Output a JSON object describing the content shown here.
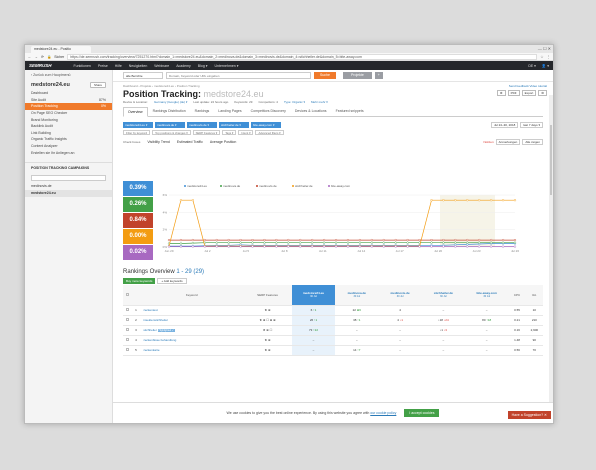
{
  "browser": {
    "tab_title": "medstore24.eu - Positio",
    "window_controls": "— ☐ ✕",
    "secure_label": "Sicher",
    "url": "https://de.semrush.com/tracking/overview/7251270.html?domain_1=medstore24.eu&domain_2=medinova.de&domain_3=medinovis.de&domain_4=stichheiler.de&domain_5=bite-away.com"
  },
  "nav": {
    "logo": "SEMRUSH",
    "items": [
      "Funktionen",
      "Preise",
      "Hilfe",
      "Neuigkeiten",
      "Webinare",
      "Academy",
      "Blog ▾",
      "Unternehmen ▾"
    ],
    "right": [
      "DE ▾",
      "👤 ▾"
    ]
  },
  "sidebar": {
    "back": "‹  Zurück zum Hauptmenü",
    "project": "medstore24.eu",
    "share": "Share",
    "items": [
      {
        "label": "Dashboard",
        "badge": ""
      },
      {
        "label": "Site Audit",
        "badge": "87%"
      },
      {
        "label": "Position Tracking",
        "badge": "0%"
      },
      {
        "label": "On Page SEO Checker",
        "badge": ""
      },
      {
        "label": "Brand Monitoring",
        "badge": ""
      },
      {
        "label": "Backlink Audit",
        "badge": ""
      },
      {
        "label": "Link Building",
        "badge": ""
      },
      {
        "label": "Organic Traffic Insights",
        "badge": ""
      },
      {
        "label": "Content Analyzer",
        "badge": ""
      },
      {
        "label": "Erstellen sie Ihr Anliegen an",
        "badge": ""
      }
    ],
    "campaigns_title": "POSITION TRACKING CAMPAIGNS",
    "campaign_search_placeholder": "",
    "campaigns": [
      "medinovis.de",
      "medstore24.eu"
    ]
  },
  "search": {
    "scope": "alle Berichte",
    "placeholder": "Domain, Keyword oder URL eingeben",
    "button": "Suche",
    "projects": "Projekte",
    "plus": "+"
  },
  "breadcrumbs": "Dashboard  ›  Projekte  ›  medstore24.eu  ›  Position Tracking",
  "page": {
    "title": "Position Tracking:",
    "title_domain": "medstore24.eu",
    "header_links": "Send feedback   Video tutorial",
    "header_buttons": [
      "⚙",
      "PDF",
      "Export",
      "⚙"
    ],
    "meta": [
      "Device & Location:",
      "Germany (Google) (de) ▾",
      "Last update: 24 hours ago",
      "Keywords: 29",
      "Competitors: 4",
      "Type: Organic ▾",
      "Mehr mehr ▾"
    ]
  },
  "tabs": [
    "Overview",
    "Rankings Distribution",
    "Rankings",
    "Landing Pages",
    "Competitors Discovery",
    "Devices & Locations",
    "Featured snippets"
  ],
  "filters": {
    "domains": [
      "medstore24.eu ▾",
      "medinova.de ▾",
      "medinovis.de ▾",
      "stichheiler.de ▾",
      "bite-away.com ▾"
    ],
    "date_range": "Jul 24–30, 2018",
    "days": "last 7 days ▾",
    "subfilters": [
      "Filter by keyword",
      "Top positions & changes ▾",
      "SERP Features ▾",
      "Tags ▾",
      "Intent ▾",
      "Advanced filters ▾"
    ]
  },
  "chart_header": {
    "check": "Check boxes",
    "visibility": "Visibility Trend",
    "traffic": "Estimated Traffic",
    "avgpos": "Average Position",
    "notes": "Notizen",
    "buttons": [
      "Anmerkungen",
      "Alle zeigen"
    ]
  },
  "metrics": [
    {
      "value": "0.39%",
      "color": "#3f8fd6"
    },
    {
      "value": "0.26%",
      "color": "#43a047"
    },
    {
      "value": "0.84%",
      "color": "#c1432b"
    },
    {
      "value": "0.00%",
      "color": "#f39c12"
    },
    {
      "value": "0.02%",
      "color": "#a869c1"
    }
  ],
  "chart_data": {
    "type": "line",
    "categories": [
      "Jun 29",
      "Jul 2",
      "Jul 5",
      "Jul 8",
      "Jul 11",
      "Jul 14",
      "Jul 17",
      "Jul 20",
      "Jul 23",
      "Jul 26"
    ],
    "ylim": [
      0,
      6
    ],
    "yticks": [
      "6%",
      "4%",
      "2%",
      "0%"
    ],
    "series": [
      {
        "name": "medstore24.eu",
        "color": "#3f8fd6",
        "values": [
          0.1,
          0.1,
          0.1,
          0.15,
          0.2,
          0.2,
          0.25,
          0.2,
          0.2,
          0.2,
          0.2,
          0.2,
          0.2,
          0.2,
          0.2,
          0.2,
          0.2,
          0.2,
          0.2,
          0.2,
          0.2,
          0.2,
          0.2,
          0.2,
          0.25,
          0.3,
          0.35,
          0.4,
          0.4,
          0.4
        ]
      },
      {
        "name": "medinova.de",
        "color": "#43a047",
        "values": [
          0.4,
          0.4,
          0.45,
          0.5,
          0.5,
          0.5,
          0.5,
          0.5,
          0.5,
          0.5,
          0.5,
          0.5,
          0.5,
          0.5,
          0.5,
          0.5,
          0.5,
          0.5,
          0.5,
          0.5,
          0.5,
          0.5,
          0.5,
          0.5,
          0.5,
          0.5,
          0.5,
          0.5,
          0.5,
          0.5
        ]
      },
      {
        "name": "medinovis.de",
        "color": "#c1432b",
        "values": [
          0.8,
          0.8,
          0.8,
          0.8,
          0.8,
          0.8,
          0.8,
          0.8,
          0.8,
          0.8,
          0.8,
          0.8,
          0.8,
          0.8,
          0.8,
          0.8,
          0.8,
          0.8,
          0.8,
          0.8,
          0.8,
          0.8,
          0.8,
          0.8,
          0.8,
          0.8,
          0.8,
          0.8,
          0.8,
          0.8
        ]
      },
      {
        "name": "stichheiler.de",
        "color": "#f39c12",
        "values": [
          0.1,
          5.4,
          5.4,
          0.1,
          0.1,
          0.1,
          0.1,
          0.1,
          0.1,
          0.1,
          0.1,
          0.1,
          0.1,
          0.1,
          0.1,
          0.1,
          0.1,
          0.1,
          0.1,
          0.1,
          0.1,
          0.1,
          5.4,
          5.4,
          5.4,
          5.4,
          5.4,
          5.4,
          5.4,
          5.4
        ]
      },
      {
        "name": "bite-away.com",
        "color": "#a869c1",
        "values": [
          0.05,
          0.05,
          0.05,
          0.05,
          0.05,
          0.05,
          0.05,
          0.05,
          0.05,
          0.05,
          0.05,
          0.05,
          0.05,
          0.05,
          0.05,
          0.05,
          0.05,
          0.05,
          0.05,
          0.05,
          0.05,
          0.05,
          0.05,
          0.05,
          0.05,
          0.05,
          0.05,
          0.05,
          0.05,
          0.05
        ]
      }
    ]
  },
  "rankings": {
    "title": "Rankings Overview",
    "count": "1 - 29 (29)",
    "buy": "Buy more keywords",
    "add": "+ Add keywords",
    "columns": [
      "",
      "",
      "Keyword",
      "SERP Features",
      "medstore24.eu",
      "medinova.de",
      "medinovis.de",
      "stichheiler.de",
      "bite-away.com",
      "CPC",
      "Vol."
    ],
    "subcols": [
      "30 Jul",
      "Diff"
    ],
    "rows": [
      {
        "n": "1",
        "kw": "zeckentest",
        "tag": "",
        "serp": "★ ⊕",
        "me": [
          "6",
          "↑1"
        ],
        "c1": [
          "22",
          "⊕6"
        ],
        "c2": [
          "4",
          ""
        ],
        "c3": [
          "–",
          ""
        ],
        "c4": [
          "–",
          ""
        ],
        "cpc": "0.55",
        "vol": "10"
      },
      {
        "n": "2",
        "kw": "insektenstichheiler",
        "tag": "",
        "serp": "★ ⊕ ☐ ⊕ ⊕",
        "me": [
          "26",
          "↑1"
        ],
        "c1": [
          "38",
          "↑1"
        ],
        "c2": [
          "4",
          "↓1"
        ],
        "c3": [
          "↓18",
          "↓24"
        ],
        "c4": [
          "80",
          "↑18"
        ],
        "cpc": "0.21",
        "vol": "210"
      },
      {
        "n": "3",
        "kw": "stichheiler",
        "tag": "Highlighted ✓",
        "serp": "★ ⊕ ☐",
        "me": [
          "73",
          "↑22"
        ],
        "c1": [
          "–",
          ""
        ],
        "c2": [
          "–",
          ""
        ],
        "c3": [
          "↓1",
          "↓3"
        ],
        "c4": [
          "–",
          ""
        ],
        "cpc": "0.16",
        "vol": "2,900"
      },
      {
        "n": "4",
        "kw": "zeckenbisse behandlung",
        "tag": "",
        "serp": "★ ⊕",
        "me": [
          "–",
          ""
        ],
        "c1": [
          "–",
          ""
        ],
        "c2": [
          "–",
          ""
        ],
        "c3": [
          "–",
          ""
        ],
        "c4": [
          "–",
          ""
        ],
        "cpc": "1.48",
        "vol": "90"
      },
      {
        "n": "5",
        "kw": "zeckenkarte",
        "tag": "",
        "serp": "★ ⊕",
        "me": [
          "–",
          ""
        ],
        "c1": [
          "14",
          "↑7"
        ],
        "c2": [
          "–",
          ""
        ],
        "c3": [
          "–",
          ""
        ],
        "c4": [
          "–",
          ""
        ],
        "cpc": "0.56",
        "vol": "70"
      }
    ]
  },
  "cookie": {
    "text": "We use cookies to give you the best online experience. By using this website you agree with",
    "link": "our cookie policy",
    "accept": "I accept cookies"
  },
  "suggestion": "Have a Suggestion? ✕"
}
